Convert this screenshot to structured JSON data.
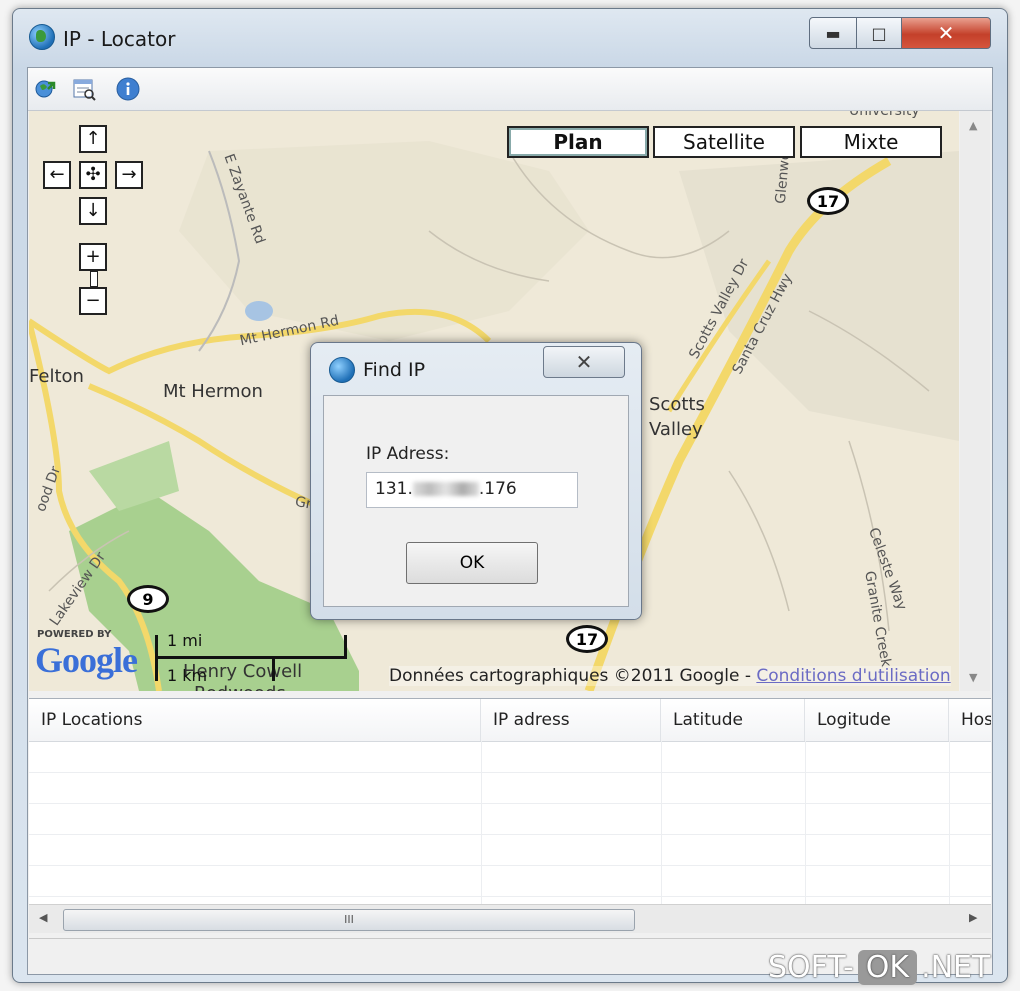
{
  "window": {
    "title": "IP - Locator"
  },
  "toolbar": {
    "icons": [
      "locate-icon",
      "report-icon",
      "info-icon"
    ]
  },
  "map": {
    "map_types": [
      "Plan",
      "Satellite",
      "Mixte"
    ],
    "active_map_type": "Plan",
    "places": [
      "Felton",
      "Mt Hermon",
      "Scotts",
      "Valley",
      "Henry Cowell",
      "Redwoods"
    ],
    "roads": [
      "Mt Hermon Rd",
      "E Zayante Rd",
      "Scotts Valley Dr",
      "Santa Cruz Hwy",
      "Glenwood",
      "Gra",
      "Lakeview Dr",
      "ood Dr",
      "Celeste Way",
      "Granite Creek",
      "University"
    ],
    "shields": [
      "17",
      "9",
      "17"
    ],
    "powered_by": "POWERED BY",
    "logo": "Google",
    "scale_mi": "1 mi",
    "scale_km": "1 km",
    "copyright": "Données cartographiques ©2011 Google -",
    "terms_link": "Conditions d'utilisation"
  },
  "dialog": {
    "title": "Find IP",
    "label": "IP Adress:",
    "ip_prefix": "131.",
    "ip_suffix": ".176",
    "ok_label": "OK"
  },
  "table": {
    "columns": [
      "IP Locations",
      "IP adress",
      "Latitude",
      "Logitude",
      "Hos"
    ],
    "rows": []
  },
  "hscroll": {
    "thumb": "III"
  },
  "watermark": {
    "left": "SOFT-",
    "mid": "OK",
    "right": ".NET"
  },
  "colors": {
    "park": "#a8d08f",
    "road": "#f7e27a",
    "land": "#f0ebdc",
    "close": "#c4402a"
  }
}
